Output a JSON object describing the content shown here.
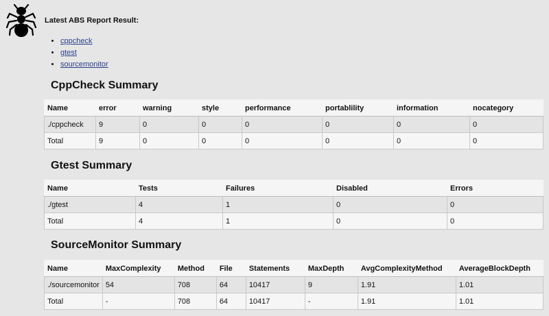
{
  "header": {
    "report_title": "Latest ABS Report Result:",
    "links": [
      "cppcheck",
      "gtest",
      "sourcemonitor"
    ]
  },
  "cppcheck": {
    "title": "CppCheck Summary",
    "columns": [
      "Name",
      "error",
      "warning",
      "style",
      "performance",
      "portablility",
      "information",
      "nocategory"
    ],
    "rows": [
      [
        "./cppcheck",
        "9",
        "0",
        "0",
        "0",
        "0",
        "0",
        "0"
      ],
      [
        "Total",
        "9",
        "0",
        "0",
        "0",
        "0",
        "0",
        "0"
      ]
    ]
  },
  "gtest": {
    "title": "Gtest Summary",
    "columns": [
      "Name",
      "Tests",
      "Failures",
      "Disabled",
      "Errors"
    ],
    "rows": [
      [
        "./gtest",
        "4",
        "1",
        "0",
        "0"
      ],
      [
        "Total",
        "4",
        "1",
        "0",
        "0"
      ]
    ]
  },
  "sourcemonitor": {
    "title": "SourceMonitor Summary",
    "columns": [
      "Name",
      "MaxComplexity",
      "Method",
      "File",
      "Statements",
      "MaxDepth",
      "AvgComplexityMethod",
      "AverageBlockDepth"
    ],
    "rows": [
      [
        "./sourcemonitor",
        "54",
        "708",
        "64",
        "10417",
        "9",
        "1.91",
        "1.01"
      ],
      [
        "Total",
        "-",
        "708",
        "64",
        "10417",
        "-",
        "1.91",
        "1.01"
      ]
    ]
  }
}
